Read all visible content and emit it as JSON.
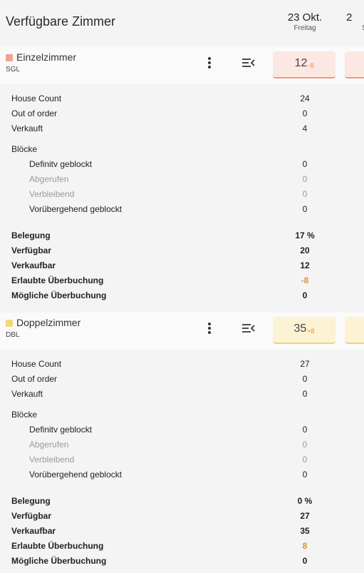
{
  "header": {
    "title": "Verfügbare Zimmer",
    "dates": [
      {
        "date": "23 Okt.",
        "weekday": "Freitag"
      },
      {
        "date": "2",
        "weekday": "S"
      }
    ]
  },
  "rooms": [
    {
      "name": "Einzelzimmer",
      "code": "SGL",
      "color": "#f0a48f",
      "tile_bg": "#fbe8e2",
      "tile_border": "#ec9a86",
      "available": "12",
      "available_delta": "-8",
      "rows": [
        {
          "label": "House Count",
          "value": "24"
        },
        {
          "label": "Out of order",
          "value": "0"
        },
        {
          "label": "Verkauft",
          "value": "4"
        },
        {
          "label": "Blöcke",
          "value": ""
        },
        {
          "label": "Definitv geblockt",
          "value": "0"
        },
        {
          "label": "Abgerufen",
          "value": "0"
        },
        {
          "label": "Verbleibend",
          "value": "0"
        },
        {
          "label": "Vorübergehend geblockt",
          "value": "0"
        },
        {
          "label": "Belegung",
          "value": "17 %"
        },
        {
          "label": "Verfügbar",
          "value": "20"
        },
        {
          "label": "Verkaufbar",
          "value": "12"
        },
        {
          "label": "Erlaubte Überbuchung",
          "value": "-8"
        },
        {
          "label": "Mögliche Überbuchung",
          "value": "0"
        }
      ]
    },
    {
      "name": "Doppelzimmer",
      "code": "DBL",
      "color": "#f3d97a",
      "tile_bg": "#fcf2d4",
      "tile_border": "#f1d47c",
      "available": "35",
      "available_delta": "+8",
      "rows": [
        {
          "label": "House Count",
          "value": "27"
        },
        {
          "label": "Out of order",
          "value": "0"
        },
        {
          "label": "Verkauft",
          "value": "0"
        },
        {
          "label": "Blöcke",
          "value": ""
        },
        {
          "label": "Definitv geblockt",
          "value": "0"
        },
        {
          "label": "Abgerufen",
          "value": "0"
        },
        {
          "label": "Verbleibend",
          "value": "0"
        },
        {
          "label": "Vorübergehend geblockt",
          "value": "0"
        },
        {
          "label": "Belegung",
          "value": "0 %"
        },
        {
          "label": "Verfügbar",
          "value": "27"
        },
        {
          "label": "Verkaufbar",
          "value": "35"
        },
        {
          "label": "Erlaubte Überbuchung",
          "value": "8"
        },
        {
          "label": "Mögliche Überbuchung",
          "value": "0"
        }
      ]
    }
  ],
  "colors": {
    "orange_value": "#e6912b",
    "muted_text": "#9a9a9a"
  }
}
